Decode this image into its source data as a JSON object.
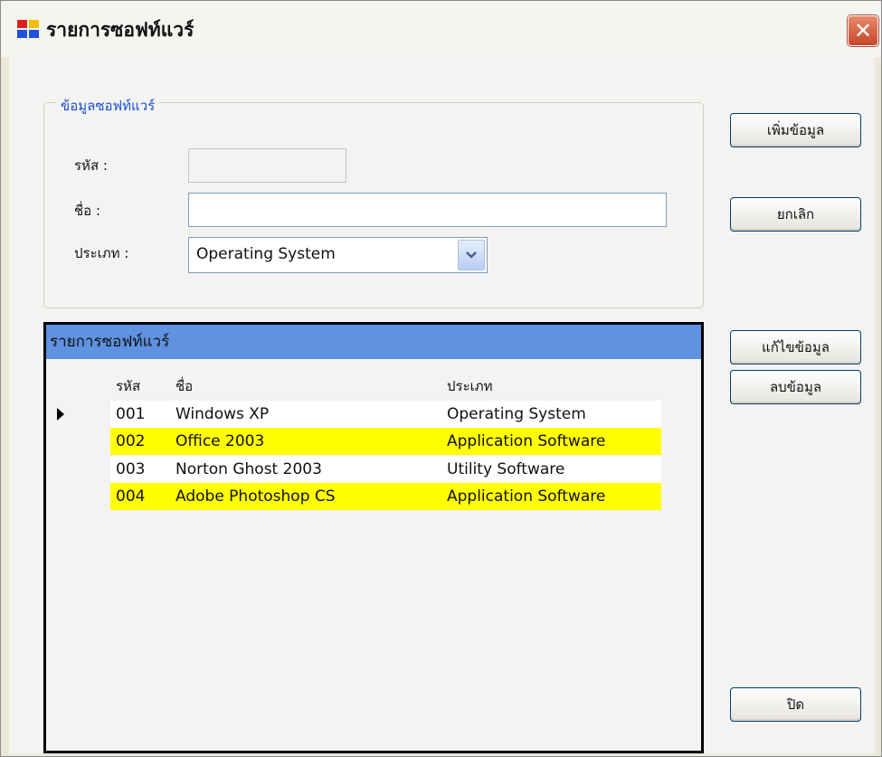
{
  "window": {
    "title": "รายการซอฟท์แวร์",
    "close_label": "✕"
  },
  "groupbox": {
    "caption": "ข้อมูลซอฟท์แวร์"
  },
  "form": {
    "code_label": "รหัส :",
    "code_value": "",
    "name_label": "ชื่อ :",
    "name_value": "",
    "type_label": "ประเภท :",
    "type_selected": "Operating System"
  },
  "buttons": {
    "add": "เพิ่มข้อมูล",
    "cancel": "ยกเลิก",
    "edit": "แก้ไขข้อมูล",
    "delete": "ลบข้อมูล",
    "close": "ปิด"
  },
  "grid": {
    "caption": "รายการซอฟท์แวร์",
    "columns": [
      "รหัส",
      "ชื่อ",
      "ประเภท"
    ],
    "rows": [
      {
        "code": "001",
        "name": "Windows XP",
        "type": "Operating System",
        "bg": "#ffffff"
      },
      {
        "code": "002",
        "name": "Office 2003",
        "type": "Application Software",
        "bg": "#ffff00"
      },
      {
        "code": "003",
        "name": "Norton Ghost 2003",
        "type": "Utility Software",
        "bg": "#ffffff"
      },
      {
        "code": "004",
        "name": "Adobe Photoshop CS",
        "type": "Application Software",
        "bg": "#ffff00"
      }
    ]
  },
  "colors": {
    "caption_bar": "#5f92e0",
    "group_caption": "#1a4fd8",
    "row_highlight": "#ffff00"
  },
  "icons": [
    "app-icon",
    "close-icon",
    "chevron-down-icon",
    "row-pointer-icon"
  ]
}
